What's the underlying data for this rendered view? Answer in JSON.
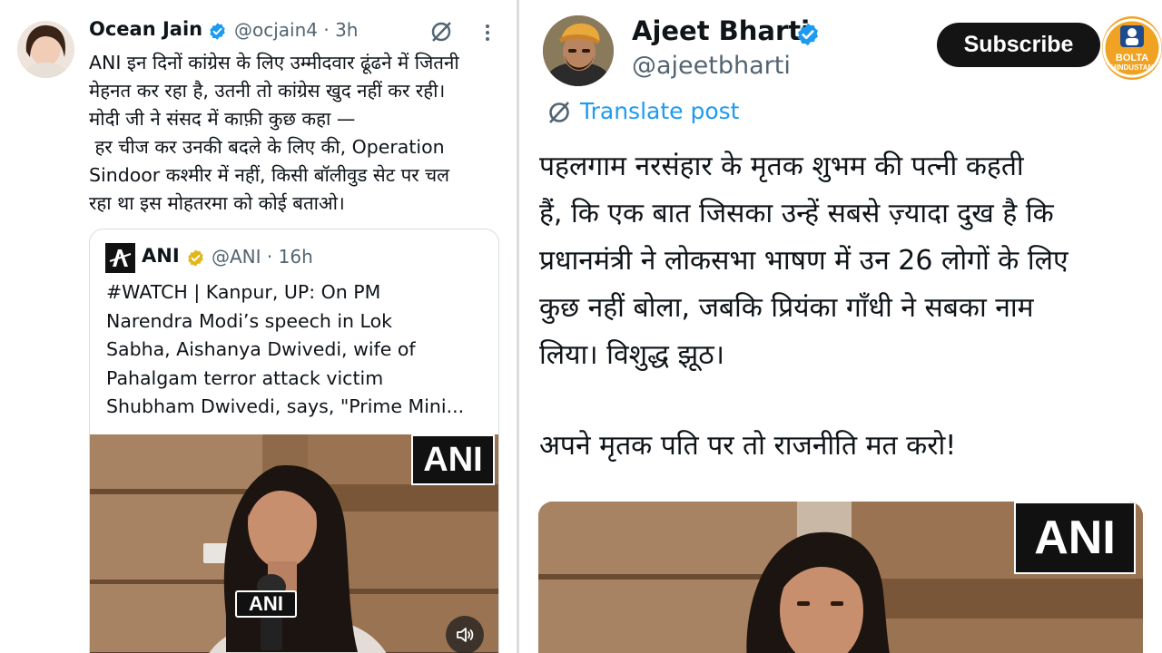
{
  "left_tweet": {
    "author_name": "Ocean Jain",
    "handle_time": "@ocjain4 · 3h",
    "lines": [
      "ANI इन दिनों कांग्रेस के लिए उम्मीदवार ढूंढने में जितनी",
      "मेहनत कर रहा है, उतनी तो कांग्रेस खुद नहीं कर रही।",
      "मोदी जी ने संसद में काफ़ी कुछ कहा —",
      " हर चीज कर उनकी बदले के लिए की, Operation",
      "Sindoor कश्मीर में नहीं, किसी बॉलीवुड सेट पर चल",
      "रहा था इस मोहतरमा को कोई बताओ।"
    ],
    "icons": [
      "verified-badge-icon",
      "grok-icon",
      "more-options-icon"
    ],
    "quote": {
      "author_name": "ANI",
      "handle_time": "@ANI · 16h",
      "lines": [
        "#WATCH | Kanpur, UP: On PM",
        "Narendra Modi’s speech in Lok",
        "Sabha, Aishanya Dwivedi, wife of",
        "Pahalgam terror attack victim",
        "Shubham Dwivedi, says, \"Prime Mini..."
      ],
      "video_watermark": "ANI",
      "mic_label": "ANI",
      "icons": [
        "ani-avatar-icon",
        "gold-verified-badge-icon",
        "mute-icon"
      ]
    }
  },
  "right_tweet": {
    "author_name": "Ajeet Bharti",
    "handle": "@ajeetbharti",
    "translate_label": "Translate post",
    "lines": [
      "पहलगाम नरसंहार के मृतक शुभम की पत्नी कहती",
      "हैं, कि एक बात जिसका उन्हें सबसे ज़्यादा दुख है कि",
      "प्रधानमंत्री ने लोकसभा भाषण में उन 26 लोगों के लिए",
      "कुछ नहीं बोला, जबकि प्रियंका गाँधी ने सबका नाम",
      "लिया। विशुद्ध झूठ।"
    ],
    "line_last": "अपने मृतक पति पर तो राजनीति मत करो!",
    "video_watermark": "ANI"
  },
  "overlay": {
    "subscribe_label": "Subscribe",
    "channel_logo_line1": "BOLTA",
    "channel_logo_line2": "HINDUSTAN"
  },
  "colors": {
    "verified_blue": "#1d9bf0",
    "verified_gold": "#e2b719",
    "link_blue": "#1d9bf0",
    "secondary_text": "#536471"
  }
}
